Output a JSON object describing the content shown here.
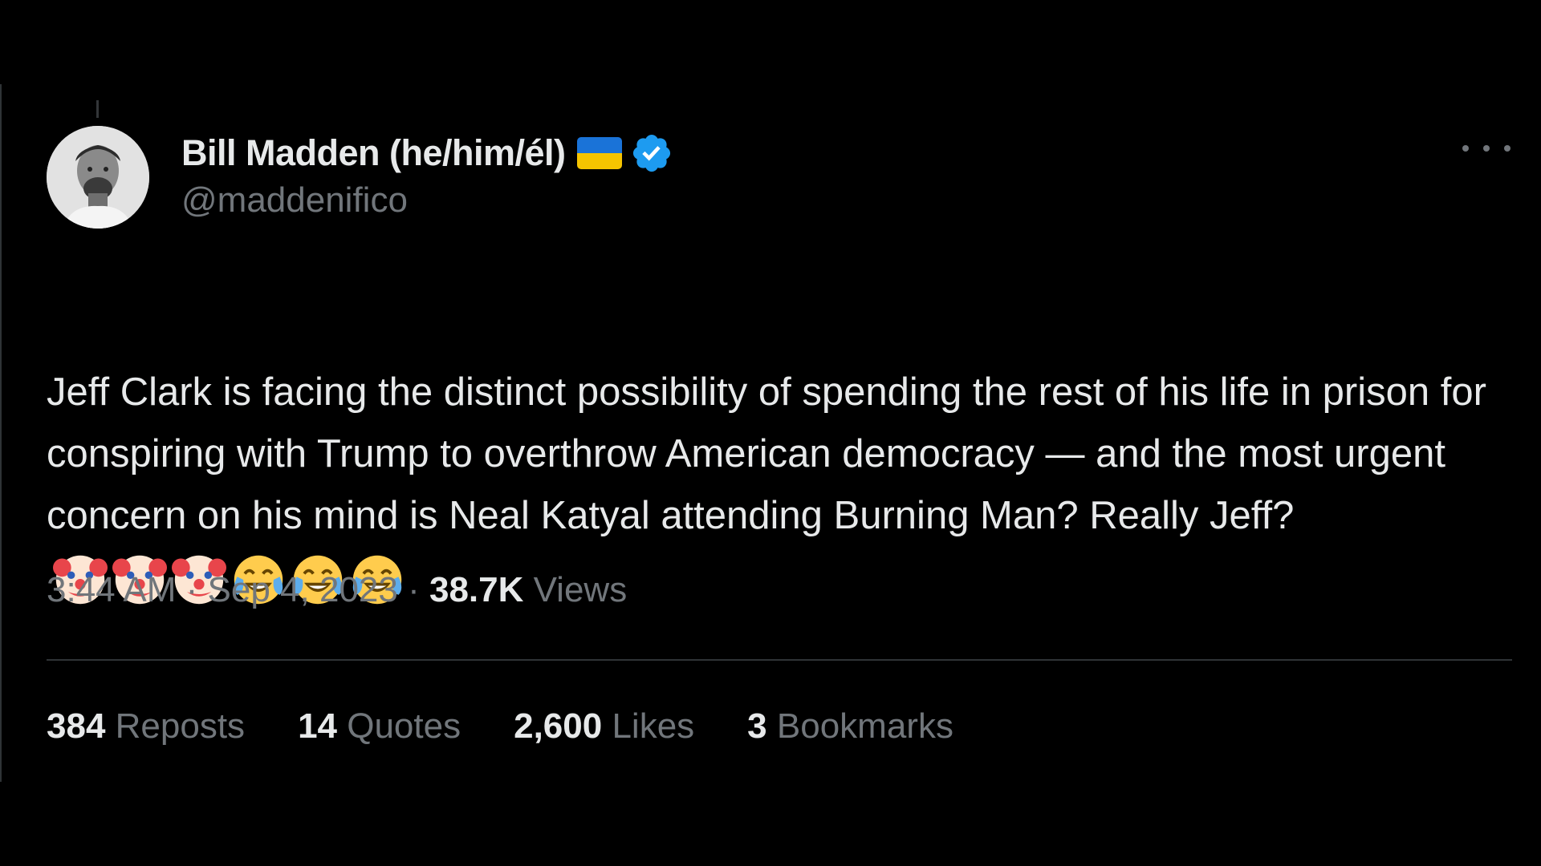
{
  "author": {
    "display_name": "Bill Madden (he/him/él)",
    "handle": "@maddenifico",
    "flag_icon": "ukraine-flag",
    "verified_icon": "verified-badge",
    "verified_color": "#1d9bf0"
  },
  "tweet": {
    "text": "Jeff Clark is facing the distinct possibility of spending the rest of his life in prison for conspiring with Trump to overthrow American democracy — and the most urgent concern on his mind is Neal Katyal attending Burning Man? Really Jeff?",
    "emojis": [
      "clown-face",
      "clown-face",
      "clown-face",
      "face-with-tears-of-joy",
      "face-with-tears-of-joy",
      "face-with-tears-of-joy"
    ]
  },
  "meta": {
    "time": "3:44 AM",
    "separator": " · ",
    "date": "Sep 4, 2023",
    "views_count": "38.7K",
    "views_label": " Views"
  },
  "stats": [
    {
      "count": "384",
      "label": " Reposts"
    },
    {
      "count": "14",
      "label": " Quotes"
    },
    {
      "count": "2,600",
      "label": " Likes"
    },
    {
      "count": "3",
      "label": " Bookmarks"
    }
  ],
  "colors": {
    "background": "#000000",
    "primary_text": "#e7e9ea",
    "secondary_text": "#71767b",
    "divider": "#2f3336"
  }
}
